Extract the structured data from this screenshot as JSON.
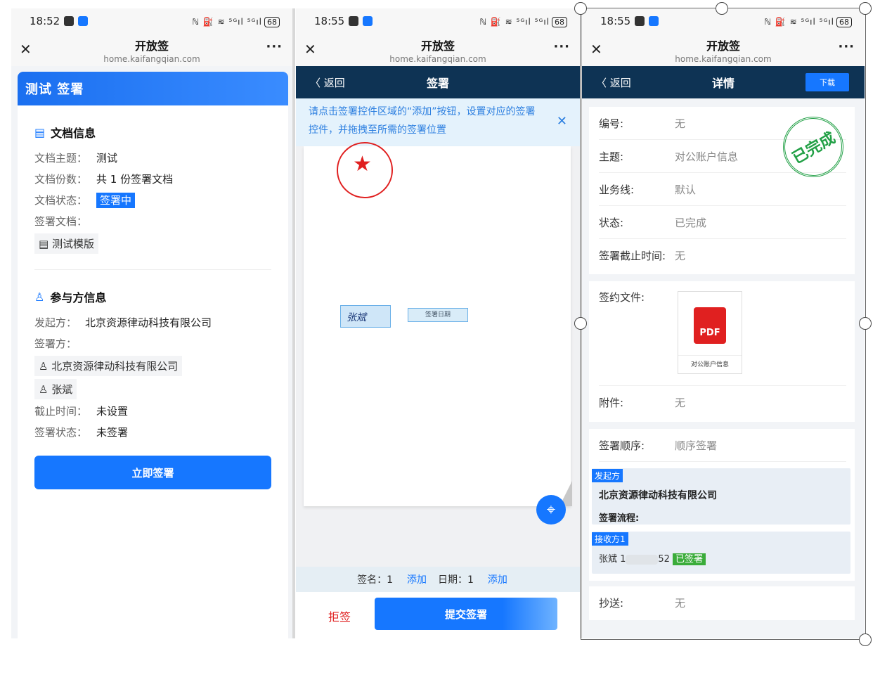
{
  "common": {
    "app_title": "开放签",
    "url": "home.kaifangqian.com",
    "close": "✕",
    "more": "···",
    "signal": "ℕ ⛽ ≋ ⁵ᴳıl ⁵ᴳıl",
    "battery": "68"
  },
  "p1": {
    "time": "18:52",
    "header": "测试 签署",
    "doc_section": "文档信息",
    "doc_rows": [
      {
        "k": "文档主题：",
        "v": "测试"
      },
      {
        "k": "文档份数：",
        "v": "共 1 份签署文档"
      }
    ],
    "status_k": "文档状态：",
    "status_v": "签署中",
    "signdoc_k": "签署文档：",
    "signdoc_chip": "测试模版",
    "party_section": "参与方信息",
    "initiator_k": "发起方：",
    "initiator_v": "北京资源律动科技有限公司",
    "signer_k": "签署方：",
    "signers": [
      "北京资源律动科技有限公司",
      "张斌"
    ],
    "deadline_k": "截止时间：",
    "deadline_v": "未设置",
    "signstatus_k": "签署状态：",
    "signstatus_v": "未签署",
    "button": "立即签署"
  },
  "p2": {
    "time": "18:55",
    "back": "〈 返回",
    "title": "签署",
    "notice": "请点击签署控件区域的“添加”按钮，设置对应的签署控件，并拖拽至所需的签署位置",
    "sig_text": "张斌",
    "date_label": "签署日期",
    "sign_count_label": "签名：1",
    "add1": "添加",
    "date_count_label": "日期：1",
    "add2": "添加",
    "reject": "拒签",
    "submit": "提交签署"
  },
  "p3": {
    "time": "18:55",
    "back": "〈 返回",
    "title": "详情",
    "download": "下载",
    "rows": [
      {
        "k": "编号:",
        "v": "无"
      },
      {
        "k": "主题:",
        "v": "对公账户信息"
      },
      {
        "k": "业务线:",
        "v": "默认"
      },
      {
        "k": "状态:",
        "v": "已完成"
      },
      {
        "k": "签署截止时间:",
        "v": "无"
      }
    ],
    "contract_k": "签约文件:",
    "pdf_label": "PDF",
    "pdf_name": "对公账户信息",
    "attach_k": "附件:",
    "attach_v": "无",
    "order_k": "签署顺序:",
    "order_v": "顺序签署",
    "initiator_tag": "发起方",
    "initiator_name": "北京资源律动科技有限公司",
    "flow_label": "签署流程:",
    "receiver_tag": "接收方1",
    "receiver_name": "张斌 1",
    "receiver_suffix": "52",
    "signed_tag": "已签署",
    "cc_k": "抄送:",
    "cc_v": "无",
    "done_stamp": "已完成"
  }
}
